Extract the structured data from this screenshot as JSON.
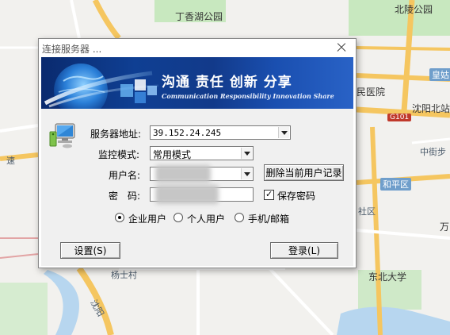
{
  "map": {
    "labels": {
      "dingxiang_park": "丁香湖公园",
      "beiling_park": "北陵公园",
      "huang": "皇姑",
      "hospital": "民医院",
      "shenyang_north": "沈阳北站",
      "g101": "G101",
      "zhongjie": "中街步",
      "heping": "和平区",
      "district_community": "社区",
      "wan": "万",
      "neu": "东北大学",
      "yangshicun": "杨士村",
      "shenyang_road": "沈阳",
      "su": "速"
    }
  },
  "dialog": {
    "title": "连接服务器 ...",
    "banner": {
      "slogan": "沟通 责任 创新 分享",
      "slogan_en": "Communication Responsibility Innovation Share"
    },
    "form": {
      "server_label": "服务器地址:",
      "server_value": "39.152.24.245",
      "mode_label": "监控模式:",
      "mode_value": "常用模式",
      "username_label": "用户名:",
      "password_label": "密　码:",
      "delete_user_button": "删除当前用户记录",
      "save_password_label": "保存密码",
      "save_password_checked": true,
      "user_types": [
        {
          "label": "企业用户",
          "checked": true
        },
        {
          "label": "个人用户",
          "checked": false
        },
        {
          "label": "手机/邮箱",
          "checked": false
        }
      ]
    },
    "buttons": {
      "settings": "设置(S)",
      "login": "登录(L)"
    }
  },
  "colors": {
    "banner_dark": "#0a2a6e",
    "banner_light": "#2962c6",
    "map_park": "#bfe3b4",
    "map_water": "#a9cdef",
    "map_road_major": "#f6c760"
  }
}
